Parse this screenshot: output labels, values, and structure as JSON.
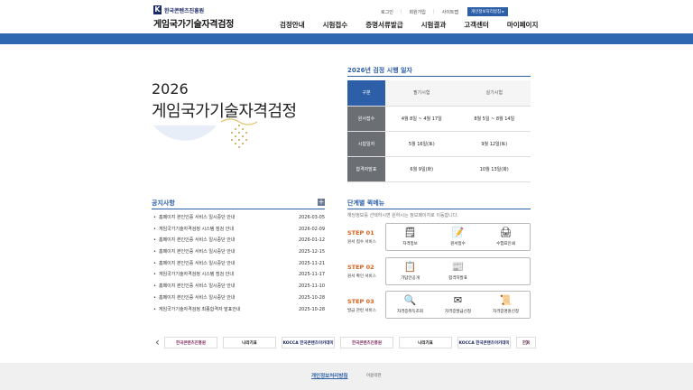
{
  "header": {
    "org_name": "한국콘텐츠진흥원",
    "site_title": "게임국가기술자격검정",
    "util_links": [
      "로그인",
      "회원가입",
      "사이트맵"
    ],
    "privacy_button": "개인정보처리방침 ▸",
    "nav": [
      "검정안내",
      "시험접수",
      "증명서류발급",
      "시험결과",
      "고객센터",
      "마이페이지"
    ]
  },
  "hero": {
    "year": "2026",
    "title": "게임국가기술자격검정"
  },
  "schedule": {
    "title": "2026년 검정 시행 일자",
    "corner": "구분",
    "columns": [
      "필기시험",
      "실기시험"
    ],
    "rows": [
      {
        "label": "원서접수",
        "written": "4월 8일 ~ 4월 17일",
        "practical": "8월 5일 ~ 8월 14일"
      },
      {
        "label": "시험일자",
        "written": "5월 16일(토)",
        "practical": "9월 12일(토)"
      },
      {
        "label": "합격자발표",
        "written": "6월 9일(화)",
        "practical": "10월 13일(화)"
      }
    ]
  },
  "notice": {
    "title": "공지사항",
    "more": "+",
    "items": [
      {
        "title": "홈페이지 본인인증 서비스 일시중단 안내",
        "date": "2026-03-05"
      },
      {
        "title": "게임국가기술자격검정 시스템 점검 안내",
        "date": "2026-02-09"
      },
      {
        "title": "홈페이지 본인인증 서비스 일시중단 안내",
        "date": "2026-01-12"
      },
      {
        "title": "홈페이지 본인인증 서비스 일시중단 안내",
        "date": "2025-12-15"
      },
      {
        "title": "홈페이지 본인인증 서비스 일시중단 안내",
        "date": "2025-11-21"
      },
      {
        "title": "게임국가기술자격검정 시스템 점검 안내",
        "date": "2025-11-17"
      },
      {
        "title": "홈페이지 본인인증 서비스 일시중단 안내",
        "date": "2025-11-10"
      },
      {
        "title": "홈페이지 본인인증 서비스 일시중단 안내",
        "date": "2025-10-28"
      },
      {
        "title": "게임국가기술자격검정 최종합격자 발표안내",
        "date": "2025-10-28"
      }
    ]
  },
  "steps": {
    "title": "단계별 퀵메뉴",
    "desc": "해당정보를 선택하시면 원하시는 정보페이지로 이동합니다.",
    "groups": [
      {
        "step": "STEP 01",
        "sub": "원서 접수 서비스",
        "items": [
          {
            "label": "자격정보",
            "icon": "document-icon"
          },
          {
            "label": "원서접수",
            "icon": "pencil-form-icon"
          },
          {
            "label": "수험표인쇄",
            "icon": "printer-icon"
          }
        ]
      },
      {
        "step": "STEP 02",
        "sub": "원서 확인 서비스",
        "items": [
          {
            "label": "가답안공개",
            "icon": "answer-sheet-icon"
          },
          {
            "label": "합격자발표",
            "icon": "notice-board-icon"
          }
        ]
      },
      {
        "step": "STEP 03",
        "sub": "발급 관련 서비스",
        "items": [
          {
            "label": "자격증취득조회",
            "icon": "magnifier-icon"
          },
          {
            "label": "자격증발급신청",
            "icon": "mail-icon"
          },
          {
            "label": "자격증명원신청",
            "icon": "certificate-icon"
          }
        ]
      }
    ]
  },
  "banners": [
    "한국콘텐츠진흥원",
    "나라기표",
    "KOCCA 한국콘텐츠아카데미",
    "한국콘텐츠진흥원",
    "나라기표",
    "KOCCA 한국콘텐츠아카데미",
    "한국"
  ],
  "footer": {
    "privacy": "개인정보처리방침",
    "terms": "이용약관"
  },
  "colors": {
    "primary": "#2d67b1",
    "step_orange": "#d9621f",
    "row_header_gray": "#6b6e73"
  }
}
